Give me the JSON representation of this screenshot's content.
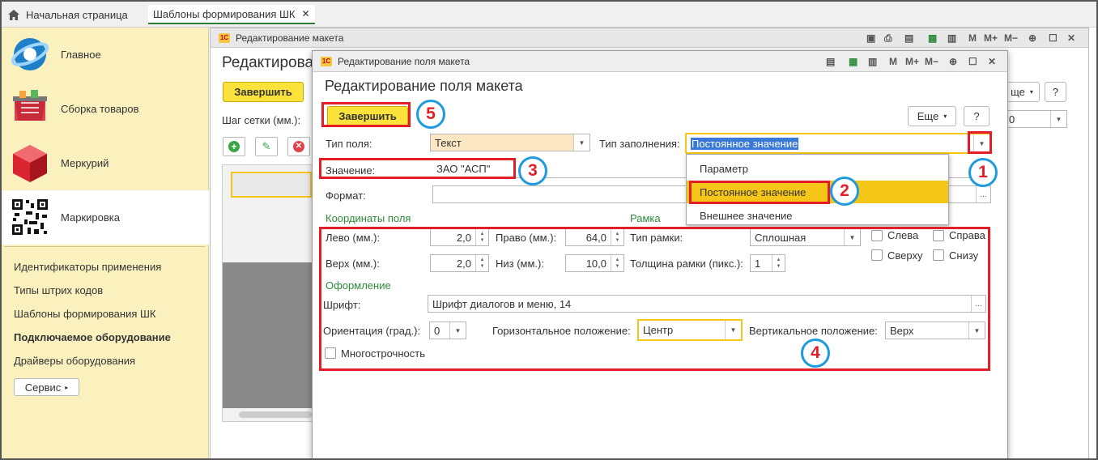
{
  "tabs": {
    "home": "Начальная страница",
    "current": "Шаблоны формирования ШК",
    "close": "✕"
  },
  "sidebar": {
    "sections": [
      {
        "label": "Главное",
        "icon": "globe-icon"
      },
      {
        "label": "Сборка товаров",
        "icon": "basket-icon"
      },
      {
        "label": "Меркурий",
        "icon": "cube-icon"
      },
      {
        "label": "Маркировка",
        "icon": "qr-code-icon"
      }
    ],
    "links": [
      "Идентификаторы применения",
      "Типы штрих кодов",
      "Шаблоны формирования ШК",
      "Подключаемое оборудование",
      "Драйверы оборудования"
    ],
    "service": "Сервис"
  },
  "win1": {
    "title": "Редактирование макета",
    "heading": "Редактирова",
    "finish": "Завершить",
    "grid_label": "Шаг сетки (мм.):",
    "more_partial": "ще",
    "help": "?",
    "zoom_partial": "0",
    "toolbar_icons": [
      "M",
      "M+",
      "M−"
    ]
  },
  "dlg": {
    "title": "Редактирование поля макета",
    "heading": "Редактирование поля макета",
    "finish": "Завершить",
    "more": "Еще",
    "help": "?",
    "field_type_label": "Тип поля:",
    "field_type_value": "Текст",
    "fill_type_label": "Тип заполнения:",
    "fill_type_value": "Постоянное значение",
    "value_label": "Значение:",
    "value_value": "ЗАО \"АСП\"",
    "format_label": "Формат:",
    "format_btn": "...",
    "coords_title": "Координаты поля",
    "frame_title": "Рамка",
    "left_label": "Лево (мм.):",
    "left_value": "2,0",
    "right_label": "Право (мм.):",
    "right_value": "64,0",
    "top_label": "Верх (мм.):",
    "top_value": "2,0",
    "bottom_label": "Низ (мм.):",
    "bottom_value": "10,0",
    "frame_type_label": "Тип рамки:",
    "frame_type_value": "Сплошная",
    "frame_width_label": "Толщина рамки (пикс.):",
    "frame_width_value": "1",
    "cb_left": "Слева",
    "cb_right": "Справа",
    "cb_top": "Сверху",
    "cb_bottom": "Снизу",
    "design_title": "Оформление",
    "font_label": "Шрифт:",
    "font_value": "Шрифт диалогов и меню, 14",
    "orient_label": "Ориентация (град.):",
    "orient_value": "0",
    "hpos_label": "Горизонтальное положение:",
    "hpos_value": "Центр",
    "vpos_label": "Вертикальное положение:",
    "vpos_value": "Верх",
    "multiline": "Многострочность",
    "toolbar_icons": [
      "M",
      "M+",
      "M−"
    ]
  },
  "dropdown": {
    "items": [
      "Параметр",
      "Постоянное значение",
      "Внешнее значение"
    ],
    "selected": 1
  },
  "callouts": {
    "c1": "1",
    "c2": "2",
    "c3": "3",
    "c4": "4",
    "c5": "5"
  },
  "colors": {
    "accent_yellow": "#fbe33b",
    "sidebar_bg": "#fbf1bf",
    "highlight_red": "#e41e26",
    "callout_blue": "#1e9be0",
    "selection_orange": "#f5c518",
    "section_green": "#2e8b3a"
  }
}
